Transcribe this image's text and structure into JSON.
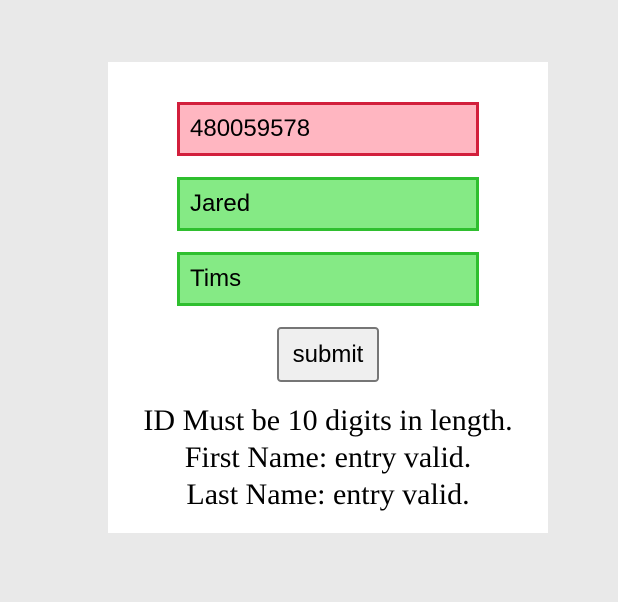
{
  "form": {
    "id_field": {
      "value": "480059578",
      "status": "invalid"
    },
    "first_name_field": {
      "value": "Jared",
      "status": "valid"
    },
    "last_name_field": {
      "value": "Tims",
      "status": "valid"
    },
    "submit_label": "submit"
  },
  "messages": {
    "id": "ID Must be 10 digits in length.",
    "first_name": "First Name: entry valid.",
    "last_name": "Last Name: entry valid."
  },
  "colors": {
    "page_background": "#e9e9e9",
    "invalid_fill": "#ffb6c1",
    "invalid_border": "#d21f3c",
    "valid_fill": "#85ea85",
    "valid_border": "#2fbf2f"
  }
}
